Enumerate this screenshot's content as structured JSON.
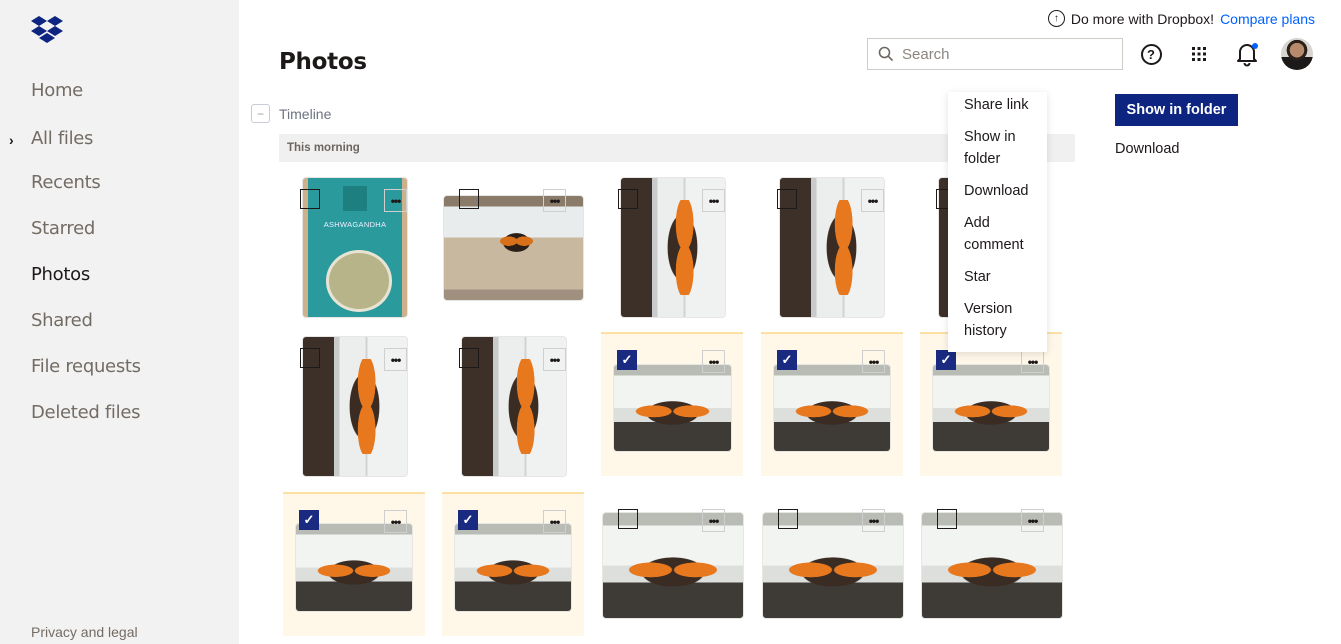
{
  "brand": {
    "logo_icon": "dropbox-logo-icon",
    "color": "#0d2481"
  },
  "sidebar": {
    "items": [
      {
        "label": "Home",
        "active": false
      },
      {
        "label": "All files",
        "active": false,
        "expandable": true
      },
      {
        "label": "Recents",
        "active": false
      },
      {
        "label": "Starred",
        "active": false
      },
      {
        "label": "Photos",
        "active": true
      },
      {
        "label": "Shared",
        "active": false
      },
      {
        "label": "File requests",
        "active": false
      },
      {
        "label": "Deleted files",
        "active": false
      }
    ],
    "footer_link": "Privacy and legal"
  },
  "header": {
    "promo_text": "Do more with Dropbox!",
    "promo_link": "Compare plans",
    "search_placeholder": "Search",
    "search_value": "",
    "icons": [
      "help-icon",
      "apps-grid-icon",
      "notification-bell-icon",
      "avatar"
    ],
    "notification_dot_color": "#0061fe"
  },
  "page": {
    "title": "Photos",
    "timeline_label": "Timeline",
    "collapse_symbol": "−",
    "section_header": "This morning"
  },
  "photos": [
    {
      "subject": "Ashwagandha product bag",
      "selected": false,
      "label": "ASHWAGANDHA"
    },
    {
      "subject": "Butterfly on window frame",
      "selected": false
    },
    {
      "subject": "Butterfly vertical",
      "selected": false
    },
    {
      "subject": "Butterfly vertical",
      "selected": false
    },
    {
      "subject": "Butterfly vertical",
      "selected": false
    },
    {
      "subject": "Butterfly vertical",
      "selected": false
    },
    {
      "subject": "Butterfly vertical",
      "selected": false
    },
    {
      "subject": "Butterfly horizontal",
      "selected": true
    },
    {
      "subject": "Butterfly horizontal",
      "selected": true
    },
    {
      "subject": "Butterfly horizontal",
      "selected": true
    },
    {
      "subject": "Butterfly horizontal",
      "selected": true
    },
    {
      "subject": "Butterfly horizontal",
      "selected": true
    },
    {
      "subject": "Butterfly horizontal",
      "selected": false
    },
    {
      "subject": "Butterfly horizontal",
      "selected": false
    },
    {
      "subject": "Butterfly horizontal",
      "selected": false
    }
  ],
  "context_menu": {
    "items": [
      "Share link",
      "Show in folder",
      "Download",
      "Add comment",
      "Star",
      "Version history"
    ]
  },
  "actions": {
    "primary_label": "Show in folder",
    "secondary_label": "Download"
  },
  "checkmark": "✓",
  "more_symbol": "•••"
}
